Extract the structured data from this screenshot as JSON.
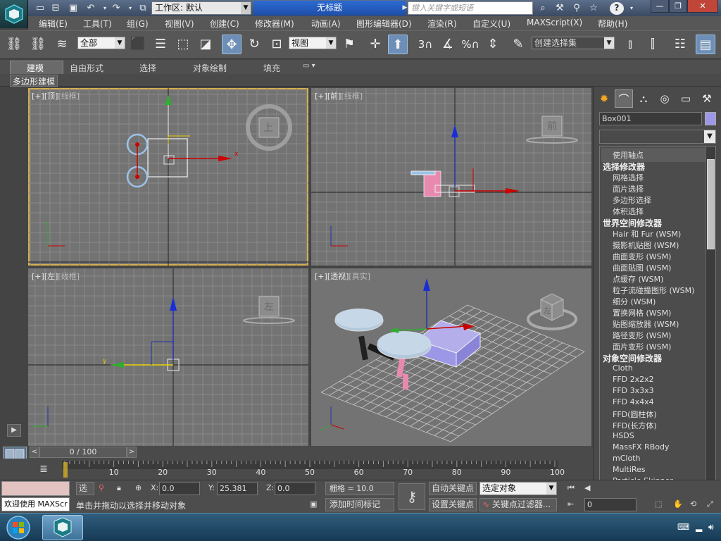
{
  "titlebar": {
    "workspace_label": "工作区: 默认",
    "doc_title": "无标题",
    "search_placeholder": "键入关键字或短语"
  },
  "menu": [
    "编辑(E)",
    "工具(T)",
    "组(G)",
    "视图(V)",
    "创建(C)",
    "修改器(M)",
    "动画(A)",
    "图形编辑器(D)",
    "渲染(R)",
    "自定义(U)",
    "MAXScript(X)",
    "帮助(H)"
  ],
  "toolbar": {
    "filter_value": "全部",
    "ref_coord_value": "视图",
    "named_selection_value": "创建选择集",
    "snap_label": "3",
    "angle_label": "%"
  },
  "ribbon": {
    "tabs": [
      "建模",
      "自由形式",
      "选择",
      "对象绘制",
      "填充"
    ],
    "sub_label": "多边形建模"
  },
  "viewports": {
    "top": {
      "plus": "[+]",
      "view": "[顶]",
      "mode": "[线框]"
    },
    "front": {
      "plus": "[+]",
      "view": "[前]",
      "mode": "[线框]"
    },
    "left": {
      "plus": "[+]",
      "view": "[左]",
      "mode": "[线框]"
    },
    "persp": {
      "plus": "[+]",
      "view": "[透视]",
      "mode": "[真实]"
    },
    "cube_top": "上",
    "cube_front": "前",
    "cube_left": "左",
    "cube_persp": "左"
  },
  "command_panel": {
    "object_name": "Box001",
    "object_color": "#9d97e8",
    "modifiers": [
      {
        "type": "item",
        "label": "使用轴点"
      },
      {
        "type": "cat",
        "label": "选择修改器"
      },
      {
        "type": "item",
        "label": "网格选择"
      },
      {
        "type": "item",
        "label": "面片选择"
      },
      {
        "type": "item",
        "label": "多边形选择"
      },
      {
        "type": "item",
        "label": "体积选择"
      },
      {
        "type": "cat",
        "label": "世界空间修改器"
      },
      {
        "type": "item",
        "label": "Hair 和 Fur (WSM)"
      },
      {
        "type": "item",
        "label": "摄影机贴图 (WSM)"
      },
      {
        "type": "item",
        "label": "曲面变形 (WSM)"
      },
      {
        "type": "item",
        "label": "曲面贴图 (WSM)"
      },
      {
        "type": "item",
        "label": "点缓存 (WSM)"
      },
      {
        "type": "item",
        "label": "粒子流碰撞图形 (WSM)"
      },
      {
        "type": "item",
        "label": "细分 (WSM)"
      },
      {
        "type": "item",
        "label": "置换网格 (WSM)"
      },
      {
        "type": "item",
        "label": "贴图缩放器 (WSM)"
      },
      {
        "type": "item",
        "label": "路径变形 (WSM)"
      },
      {
        "type": "item",
        "label": "面片变形 (WSM)"
      },
      {
        "type": "cat",
        "label": "对象空间修改器"
      },
      {
        "type": "item",
        "label": "Cloth"
      },
      {
        "type": "item",
        "label": "FFD 2x2x2"
      },
      {
        "type": "item",
        "label": "FFD 3x3x3"
      },
      {
        "type": "item",
        "label": "FFD 4x4x4"
      },
      {
        "type": "item",
        "label": "FFD(圆柱体)"
      },
      {
        "type": "item",
        "label": "FFD(长方体)"
      },
      {
        "type": "item",
        "label": "HSDS"
      },
      {
        "type": "item",
        "label": "MassFX RBody"
      },
      {
        "type": "item",
        "label": "mCloth"
      },
      {
        "type": "item",
        "label": "MultiRes"
      },
      {
        "type": "item",
        "label": "Particle Skinner"
      }
    ]
  },
  "timeline": {
    "frame_label": "0 / 100",
    "ticks": [
      "10",
      "20",
      "30",
      "40",
      "50",
      "60",
      "70",
      "80",
      "90",
      "100"
    ]
  },
  "status": {
    "maxscript_label": "欢迎使用 MAXScr",
    "selection_label": "选择",
    "x_label": "X:",
    "x_value": "0.0",
    "y_label": "Y:",
    "y_value": "25.381",
    "z_label": "Z:",
    "z_value": "0.0",
    "grid_label": "栅格 = 10.0",
    "prompt": "单击并拖动以选择并移动对象",
    "add_time_tag": "添加时间标记",
    "auto_key": "自动关键点",
    "set_key": "设置关键点",
    "key_filter": "关键点过滤器...",
    "selected_object": "选定对象",
    "current_frame": "0"
  }
}
